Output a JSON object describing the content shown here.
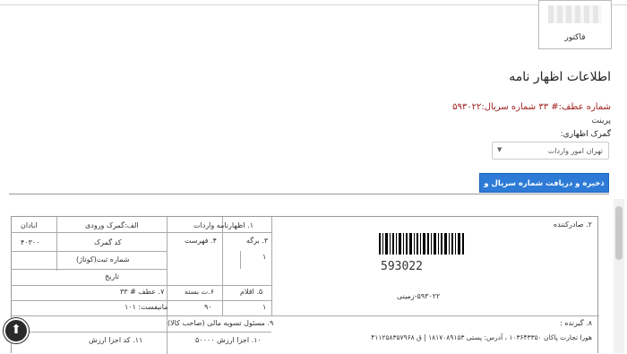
{
  "invoice_thumb": {
    "label": "فاکتور"
  },
  "section": {
    "title": "اطلاعات اظهار نامه",
    "serial_line": "شماره عطف:# ۳۳ شماره سریال:۵۹۳۰۲۲",
    "print_link": "پرینت",
    "customs_label": "گمرک اظهاری:",
    "customs_value": "تهران امور واردات",
    "save_button": "ذخیره و دریافت شماره سریال و عطف"
  },
  "form": {
    "f2_exporter": "۲. صادرکننده",
    "barcode_number": "593022",
    "serial_sub": "۵۹۳۰۲۲-زمینی",
    "f1_decl_import": "۱. اظهارنامه واردات",
    "f3_sheet": "۳. برگه",
    "f4_list": "۴. فهرست",
    "sheet_val": "۱",
    "f5_items": "۵. اقلام",
    "f6_packages": "۶.ت بسته",
    "items_val": "۱",
    "packages_val": "۹۰",
    "a_customs_entry": "الف:گمرک ورودی",
    "abadan": "ابادان",
    "customs_code": "کد گمرک",
    "customs_code_val": "۴۰۳۰۰",
    "reg_no": "شماره ثبت(کوتاژ)",
    "date": "تاریخ",
    "f7_atf": "۷. عطف # ۳۳",
    "manifest": "مانیفست: ۱۰۱",
    "f8_receiver": "۸. گیرنده :",
    "receiver_detail": "هورا تجارت پاکان ۱۰۳۶۴۳۳۵۰ ، آدرس: پستی ۱۸۱۷۰۸۹۱۵۳ | ق ۴۱۱۲۵۸۳۵۷۹۶۸",
    "f9_finance": "۹. مسئول تسویه مالی (صاحب کالا)",
    "f10_value": "۱۰. اجزا ارزش ۵۰۰۰۰",
    "f11_code": "۱۱. کد اجزا ارزش"
  },
  "icons": {
    "back_to_top": "arrow-up-circle-icon",
    "select_arrow": "triangle-down-icon"
  }
}
